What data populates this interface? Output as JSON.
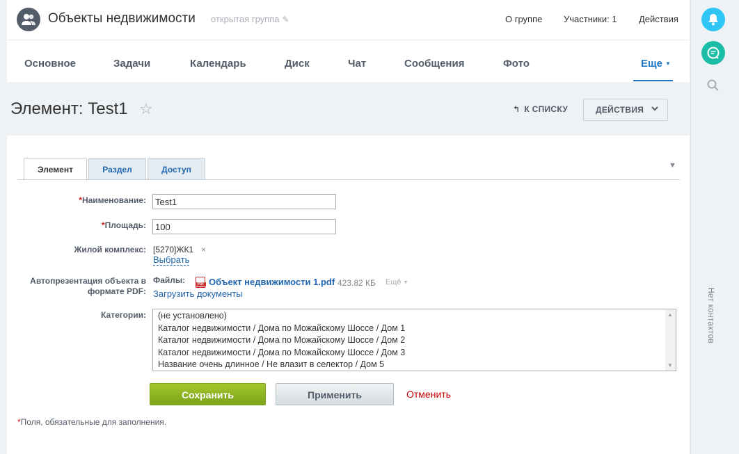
{
  "group": {
    "title": "Объекты недвижимости",
    "type": "открытая группа",
    "links": {
      "about": "О группе",
      "members": "Участники: 1",
      "actions": "Действия"
    }
  },
  "nav": {
    "items": [
      "Основное",
      "Задачи",
      "Календарь",
      "Диск",
      "Чат",
      "Сообщения",
      "Фото"
    ],
    "more": "Еще"
  },
  "page": {
    "title": "Элемент: Test1",
    "back_link": "К СПИСКУ",
    "actions_button": "ДЕЙСТВИЯ"
  },
  "tabs": [
    "Элемент",
    "Раздел",
    "Доступ"
  ],
  "form": {
    "name": {
      "label": "Наименование:",
      "value": "Test1"
    },
    "area": {
      "label": "Площадь:",
      "value": "100"
    },
    "complex": {
      "label": "Жилой комплекс:",
      "value": "[5270]ЖК1",
      "remove": "×",
      "select_link": "Выбрать"
    },
    "pdf": {
      "label_line1": "Автопрезентация объекта в",
      "label_line2": "формате PDF:",
      "files_label": "Файлы:",
      "file_name": "Объект недвижимости 1.pdf",
      "file_size": "423.82 КБ",
      "file_more": "Ещё",
      "upload_link": "Загрузить документы",
      "icon_text": "PDF"
    },
    "categories": {
      "label": "Категории:",
      "options": [
        "(не установлено)",
        "Каталог недвижимости / Дома по Можайскому Шоссе / Дом 1",
        "Каталог недвижимости / Дома по Можайскому Шоссе / Дом 2",
        "Каталог недвижимости / Дома по Можайскому Шоссе / Дом 3",
        "Название очень длинное / Не влазит в селектор / Дом 5"
      ]
    },
    "required_mark": "*"
  },
  "buttons": {
    "save": "Сохранить",
    "apply": "Применить",
    "cancel": "Отменить"
  },
  "required_note": "Поля, обязательные для заполнения.",
  "sidebar": {
    "no_contacts": "Нет контактов"
  },
  "colors": {
    "accent": "#1f78c6",
    "bell": "#2fc6f6",
    "chat": "#1bbda6",
    "save": "#8cb424",
    "cancel": "#cc0000"
  }
}
